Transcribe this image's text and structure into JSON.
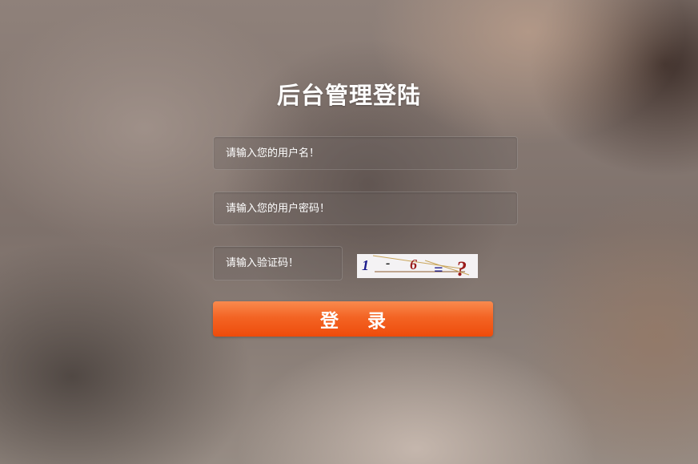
{
  "title": "后台管理登陆",
  "form": {
    "username_placeholder": "请输入您的用户名！",
    "password_placeholder": "请输入您的用户密码！",
    "captcha_placeholder": "请输入验证码！",
    "captcha_image": {
      "chars": [
        "1",
        "-",
        "6",
        "=",
        "?"
      ],
      "colors": [
        "#1a1a8c",
        "#111111",
        "#9b1c1c",
        "#1a1a8c",
        "#9b1c1c"
      ]
    },
    "login_label": "登 录"
  },
  "colors": {
    "button_top": "#f98a4e",
    "button_bottom": "#ee4b0b",
    "text": "#ffffff"
  }
}
